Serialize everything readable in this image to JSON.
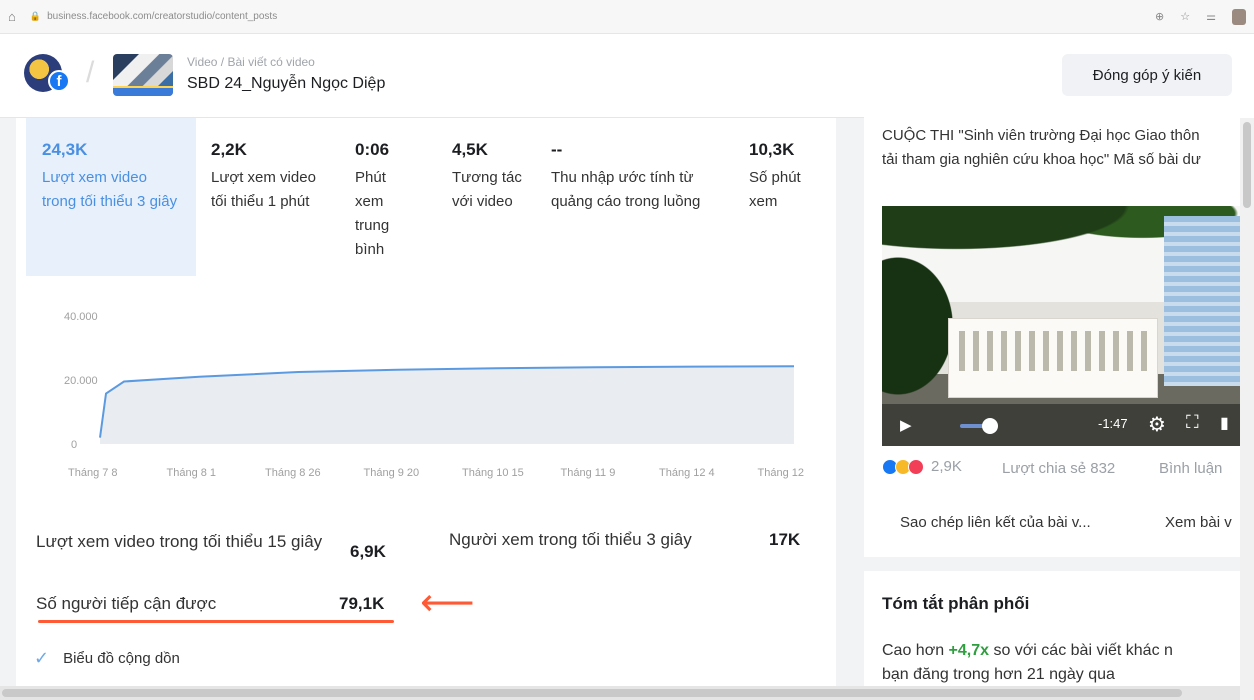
{
  "browser": {
    "url": "business.facebook.com/creatorstudio/content_posts"
  },
  "header": {
    "breadcrumb": "Video / Bài viết có video",
    "title": "SBD 24_Nguyễn Ngọc Diệp",
    "feedback_label": "Đóng góp ý kiến"
  },
  "metrics": [
    {
      "value": "24,3K",
      "label": "Lượt xem video trong tối thiểu 3 giây",
      "active": true
    },
    {
      "value": "2,2K",
      "label": "Lượt xem video tối thiểu 1 phút"
    },
    {
      "value": "0:06",
      "label": "Phút xem trung bình"
    },
    {
      "value": "4,5K",
      "label": "Tương tác với video"
    },
    {
      "value": "--",
      "label": "Thu nhập ước tính từ quảng cáo trong luồng"
    },
    {
      "value": "10,3K",
      "label": "Số phút xem"
    }
  ],
  "chart_data": {
    "type": "area",
    "x": [
      "Tháng 7 8",
      "Tháng 8 1",
      "Tháng 8 26",
      "Tháng 9 20",
      "Tháng 10 15",
      "Tháng 11 9",
      "Tháng 12 4",
      "Tháng 12"
    ],
    "series": [
      {
        "values": [
          2000,
          21000,
          22500,
          23200,
          23700,
          24000,
          24200,
          24300
        ]
      }
    ],
    "yticks": [
      "40.000",
      "20.000",
      "0"
    ],
    "ylim": [
      0,
      40000
    ],
    "line_color": "#5b9ae0",
    "fill_color": "#e9ecf0"
  },
  "stats": {
    "views15_label": "Lượt xem video trong tối thiểu 15 giây",
    "views15_value": "6,9K",
    "viewers3_label": "Người xem trong tối thiểu 3 giây",
    "viewers3_value": "17K",
    "reach_label": "Số người tiếp cận được",
    "reach_value": "79,1K",
    "cumulative_label": "Biểu đồ cộng dồn"
  },
  "post": {
    "text_line1": "CUỘC THI \"Sinh viên trường Đại học Giao thôn",
    "text_line2": "tải tham gia nghiên cứu khoa học\" Mã số bài dư",
    "video_time": "-1:47",
    "reactions_count": "2,9K",
    "shares": "Lượt chia sẻ 832",
    "comments": "Bình luận",
    "copy_link": "Sao chép liên kết của bài v...",
    "view_post": "Xem bài v"
  },
  "summary": {
    "title": "Tóm tắt phân phối",
    "line1_prefix": "Cao hơn ",
    "line1_highlight": "+4,7x",
    "line1_suffix": " so với các bài viết khác n",
    "line2": "bạn đăng trong hơn 21 ngày qua"
  },
  "colors": {
    "accent": "#4a90e2",
    "annotation_red": "#ff5a36",
    "positive": "#2e9e3e"
  }
}
